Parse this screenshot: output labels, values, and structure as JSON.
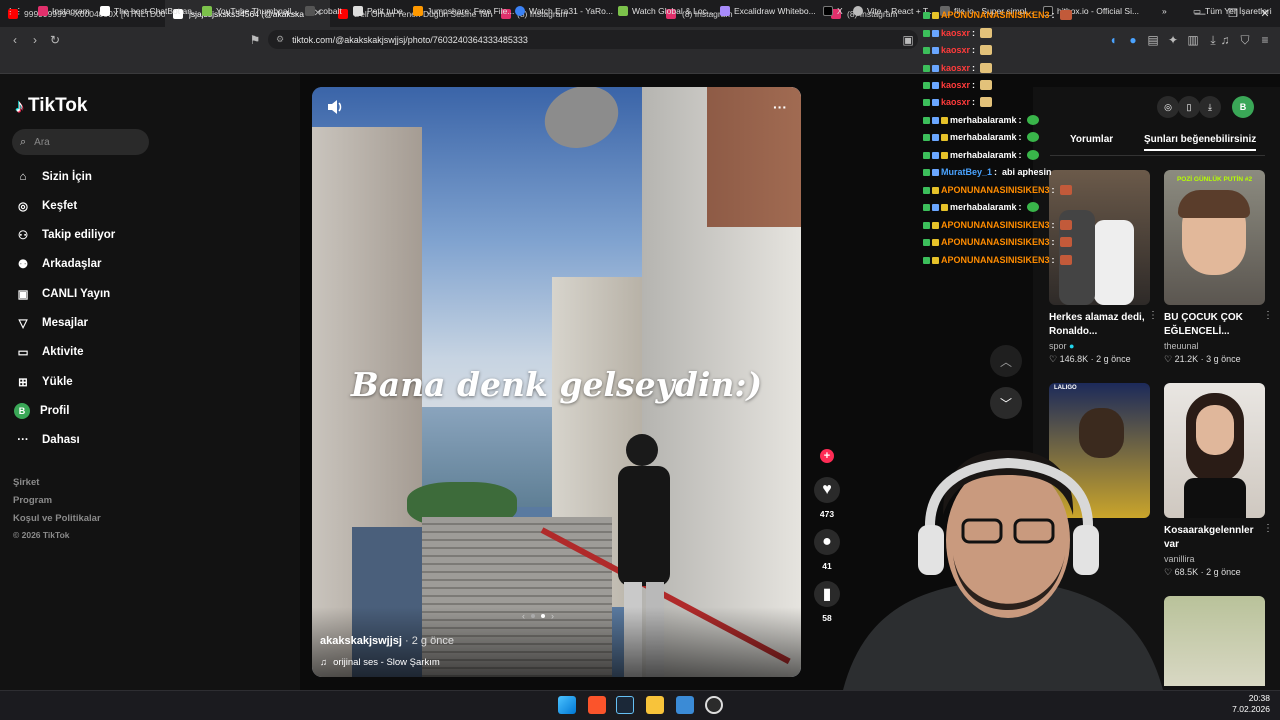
{
  "browser": {
    "tabs": [
      {
        "title": "999999999 - X0004000X [NTNLTD00",
        "color": "#ff0000"
      },
      {
        "title": "jsjajssjsksks34564 (@akakskakjs",
        "color": "#ffffff"
      },
      {
        "title": "Deli Orhan Yenen Düğün Sesine Taha",
        "color": "#ff0000"
      },
      {
        "title": "(8) Instagram",
        "color": "#e1306c"
      },
      {
        "title": "(8) Instagram",
        "color": "#e1306c"
      },
      {
        "title": "(8) Instagram",
        "color": "#e1306c"
      }
    ],
    "url": "tiktok.com/@akakskakjswjjsj/photo/7603240364333485333",
    "bookmarks": [
      "Instagram",
      "The best ChatBot an...",
      "YouTube Thumbnail...",
      "cobalt",
      "Petit tube",
      "Jumpshare: Free File...",
      "Watch Era31 - YaRo...",
      "Watch Global & Loc...",
      "Excalidraw Whitebo...",
      "X",
      "Vite + React + T...",
      "file.io - Super simpl...",
      "hitbox.io - Official Si..."
    ],
    "bookmarks_folder": "Tüm Yer İşaretleri"
  },
  "sidebar": {
    "brand": "TikTok",
    "search_placeholder": "Ara",
    "nav": [
      "Sizin İçin",
      "Keşfet",
      "Takip ediliyor",
      "Arkadaşlar",
      "CANLI Yayın",
      "Mesajlar",
      "Aktivite",
      "Yükle",
      "Profil",
      "Dahası"
    ],
    "profile_initial": "B",
    "footer": [
      "Şirket",
      "Program",
      "Koşul ve Politikalar",
      "© 2026 TikTok"
    ]
  },
  "post": {
    "overlay_text": "Bana denk gelseydin:)",
    "author": "akakskakjswjjsj",
    "time": "· 2 g önce",
    "sound": "orijinal ses - Slow Şarkım",
    "likes": "473",
    "comments": "41",
    "saves": "58"
  },
  "right_panel": {
    "profile_initial": "B",
    "tabs": [
      "Yorumlar",
      "Şunları beğenebilirsiniz"
    ],
    "cards": [
      {
        "title": "Herkes alamaz dedi, Ronaldo...",
        "user": "spor",
        "likes": "146.8K",
        "age": "2 g önce"
      },
      {
        "title": "BU ÇOCUK ÇOK EĞLENCELİ...",
        "user": "theuunal",
        "likes": "21.2K",
        "age": "3 g önce"
      },
      {
        "title": "",
        "user": "",
        "likes": "",
        "age": ""
      },
      {
        "title": "Kosaarakgelennler var",
        "user": "vanillira",
        "likes": "68.5K",
        "age": "2 g önce"
      }
    ],
    "thumb_caption_1": "POZİ GÜNLÜK PUTİN #2",
    "thumb_caption_2": "LALIGO"
  },
  "chat": [
    {
      "user": "APONUNANASINISIKEN3",
      "msg": "",
      "color": "#ff8c00"
    },
    {
      "user": "kaosxr",
      "msg": "",
      "color": "#ff3b3b"
    },
    {
      "user": "kaosxr",
      "msg": "",
      "color": "#ff3b3b"
    },
    {
      "user": "kaosxr",
      "msg": "",
      "color": "#ff3b3b"
    },
    {
      "user": "kaosxr",
      "msg": "",
      "color": "#ff3b3b"
    },
    {
      "user": "kaosxr",
      "msg": "",
      "color": "#ff3b3b"
    },
    {
      "user": "merhabalaramk",
      "msg": "",
      "color": "#ffffff"
    },
    {
      "user": "merhabalaramk",
      "msg": "",
      "color": "#ffffff"
    },
    {
      "user": "merhabalaramk",
      "msg": "",
      "color": "#ffffff"
    },
    {
      "user": "MuratBey_1",
      "msg": "abi aphesin",
      "color": "#4aa3ff"
    },
    {
      "user": "APONUNANASINISIKEN3",
      "msg": "",
      "color": "#ff8c00"
    },
    {
      "user": "merhabalaramk",
      "msg": "",
      "color": "#ffffff"
    },
    {
      "user": "APONUNANASINISIKEN3",
      "msg": "",
      "color": "#ff8c00"
    },
    {
      "user": "APONUNANASINISIKEN3",
      "msg": "",
      "color": "#ff8c00"
    },
    {
      "user": "APONUNANASINISIKEN3",
      "msg": "",
      "color": "#ff8c00"
    }
  ],
  "taskbar": {
    "time": "20:38",
    "date": "7.02.2026"
  },
  "colors": {
    "accent": "#fe2c55",
    "panel": "#121212",
    "chrome": "#2b2b2d"
  }
}
